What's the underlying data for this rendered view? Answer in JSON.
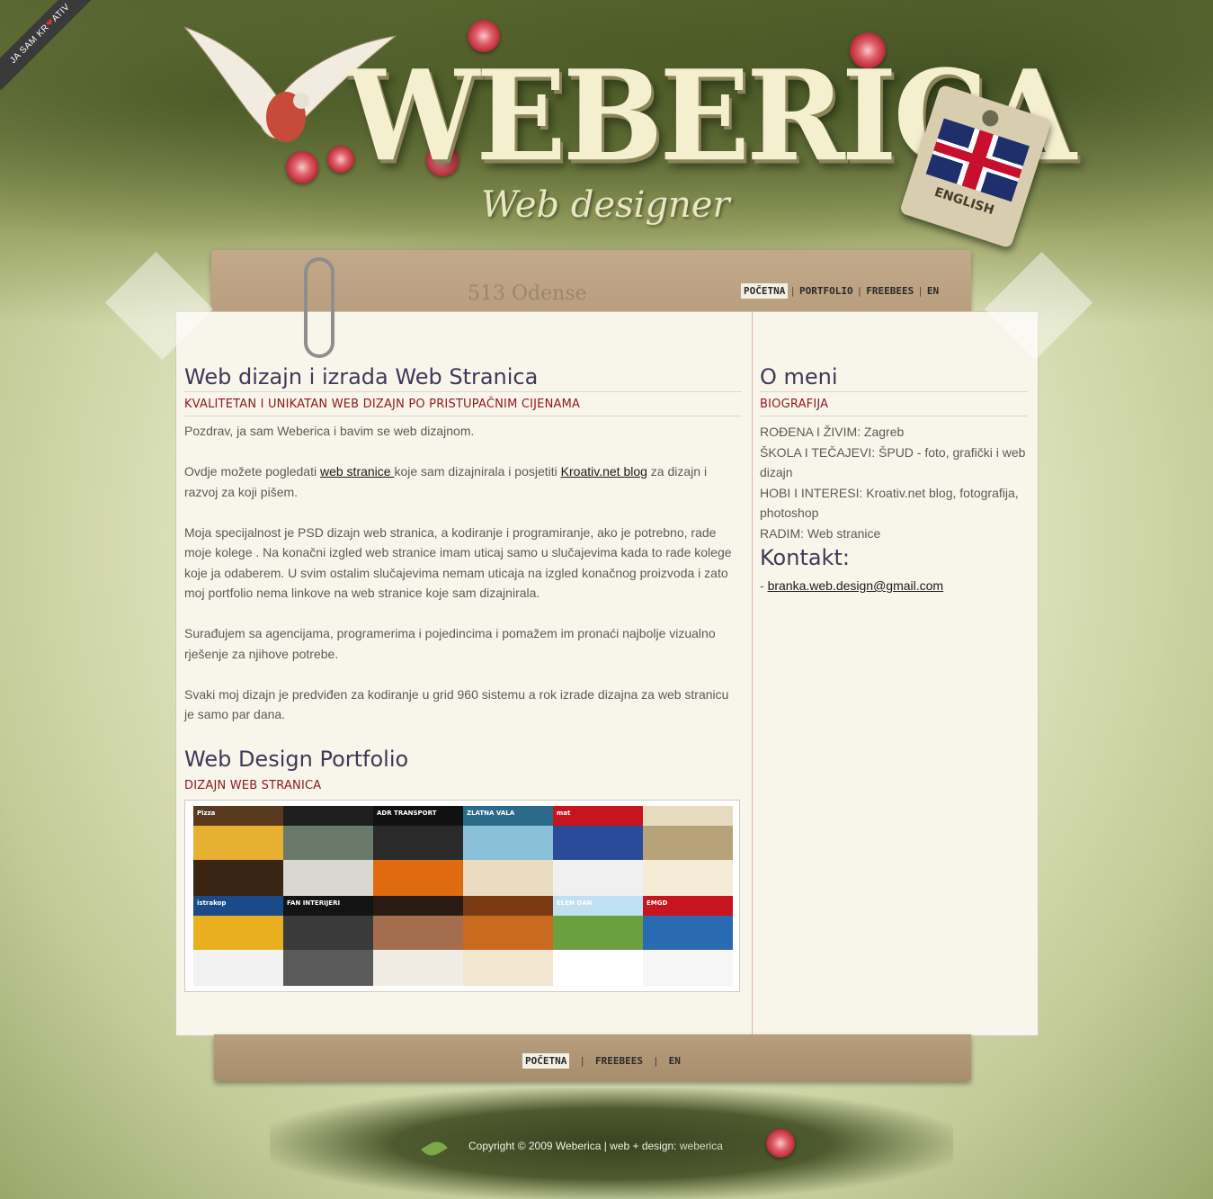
{
  "ribbon": {
    "text_before": "JA SAM KR",
    "text_after": "ATIV"
  },
  "brand": {
    "logo": "WEBERICA",
    "tagline": "Web designer",
    "lang_tag": "ENGLISH"
  },
  "nav": {
    "items": [
      {
        "label": "POČETNA",
        "active": true
      },
      {
        "label": "PORTFOLIO"
      },
      {
        "label": "FREEBEES"
      },
      {
        "label": "EN"
      }
    ],
    "separator": "|"
  },
  "stamp": "513 Odense",
  "main": {
    "title": "Web dizajn i izrada Web Stranica",
    "subtitle": "KVALITETAN I UNIKATAN WEB DIZAJN PO PRISTUPAČNIM CIJENAMA",
    "p1": "Pozdrav, ja sam Weberica i bavim se web dizajnom.",
    "p2_a": "Ovdje možete pogledati ",
    "p2_link1": "web stranice ",
    "p2_b": "koje sam dizajnirala i posjetiti ",
    "p2_link2": "Kroativ.net blog",
    "p2_c": " za dizajn i razvoj za koji pišem.",
    "p3": "Moja specijalnost je PSD dizajn web stranica, a kodiranje i programiranje, ako je potrebno, rade moje kolege . Na konačni izgled web stranice imam uticaj samo u slučajevima kada to rade kolege koje ja odaberem. U svim ostalim slučajevima nemam uticaja na izgled konačnog proizvoda i zato moj portfolio nema linkove na web stranice koje sam dizajnirala.",
    "p4": "Surađujem sa agencijama, programerima i pojedincima i pomažem im pronaći najbolje vizualno rješenje za njihove potrebe.",
    "p5": "Svaki moj dizajn je predviđen za kodiranje u grid 960 sistemu a rok izrade dizajna za web stranicu je samo par dana."
  },
  "portfolio": {
    "title": "Web Design Portfolio",
    "subtitle": "DIZAJN WEB STRANICA",
    "thumbs": [
      {
        "label": "Pizza",
        "top": "#5a3a1e",
        "mid": "#e8b030",
        "bot": "#3a2414"
      },
      {
        "label": "",
        "top": "#1e1e1e",
        "mid": "#6a7a6a",
        "bot": "#d8d8d0"
      },
      {
        "label": "ADR TRANSPORT",
        "top": "#111111",
        "mid": "#2a2a2a",
        "bot": "#e06a10"
      },
      {
        "label": "ZLATNA VALA",
        "top": "#2a6a8a",
        "mid": "#8ac0d8",
        "bot": "#e9dcc0"
      },
      {
        "label": "mat",
        "top": "#c8141e",
        "mid": "#2a4a9a",
        "bot": "#f0f0f0"
      },
      {
        "label": "",
        "top": "#e8dcc0",
        "mid": "#b8a27a",
        "bot": "#f4ecd6"
      },
      {
        "label": "istrakop",
        "top": "#1a4a8a",
        "mid": "#e8b020",
        "bot": "#f2f2f2"
      },
      {
        "label": "FAN INTERIJERI",
        "top": "#141414",
        "mid": "#3a3a3a",
        "bot": "#5a5a5a"
      },
      {
        "label": "",
        "top": "#2a1a14",
        "mid": "#a46e4e",
        "bot": "#f0ece4"
      },
      {
        "label": "",
        "top": "#7a3a12",
        "mid": "#c86a20",
        "bot": "#f2e6d0"
      },
      {
        "label": "ELEN DAN",
        "top": "#bfe0f0",
        "mid": "#6aa040",
        "bot": "#ffffff"
      },
      {
        "label": "EMGD",
        "top": "#c8141e",
        "mid": "#2a6ab0",
        "bot": "#f6f6f6"
      }
    ]
  },
  "side": {
    "title": "O meni",
    "subtitle": "BIOGRAFIJA",
    "bio": [
      "ROĐENA I ŽIVIM: Zagreb",
      "ŠKOLA I TEČAJEVI: ŠPUD - foto, grafički i web dizajn",
      "HOBI I INTERESI: Kroativ.net blog, fotografija, photoshop",
      "RADIM: Web stranice"
    ],
    "contact_title": "Kontakt:",
    "contact_prefix": "- ",
    "email": "branka.web.design@gmail.com"
  },
  "footer": {
    "nav": [
      {
        "label": "POČETNA",
        "active": true
      },
      {
        "label": "FREEBEES"
      },
      {
        "label": "EN"
      }
    ],
    "separator": "|",
    "copyright": "Copyright © 2009 Weberica | web + design: ",
    "author": "weberica"
  },
  "colors": {
    "accent_red": "#8e1a22",
    "heading": "#3e3958",
    "text": "#5e5a58",
    "paper": "#f8f5ea"
  }
}
